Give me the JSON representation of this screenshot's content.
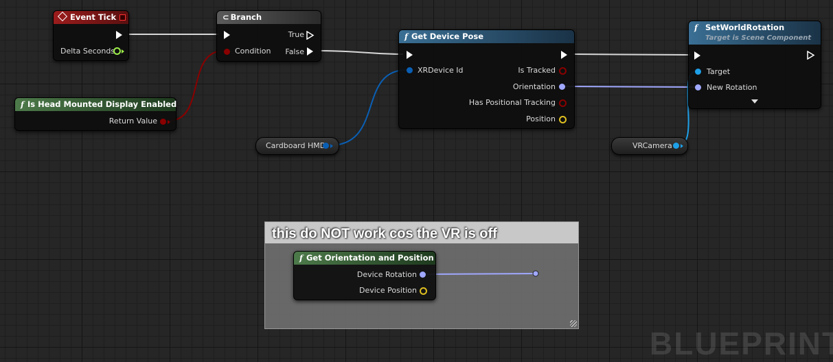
{
  "nodes": {
    "event_tick": {
      "title": "Event Tick",
      "delta_seconds": "Delta Seconds"
    },
    "branch": {
      "title": "Branch",
      "condition": "Condition",
      "true_label": "True",
      "false_label": "False"
    },
    "is_hmd_enabled": {
      "title": "Is Head Mounted Display Enabled",
      "return_value": "Return Value"
    },
    "get_device_pose": {
      "title": "Get Device Pose",
      "xr_device_id": "XRDevice Id",
      "is_tracked": "Is Tracked",
      "orientation": "Orientation",
      "has_positional_tracking": "Has Positional Tracking",
      "position": "Position"
    },
    "set_world_rotation": {
      "title": "SetWorldRotation",
      "subtitle": "Target is Scene Component",
      "target": "Target",
      "new_rotation": "New Rotation"
    },
    "cardboard_hmd": {
      "label": "Cardboard HMD"
    },
    "vr_camera": {
      "label": "VRCamera"
    },
    "get_orientation_position": {
      "title": "Get Orientation and Position",
      "device_rotation": "Device Rotation",
      "device_position": "Device Position"
    }
  },
  "comment": {
    "title": "this do NOT work cos the VR is off"
  },
  "watermark": "BLUEPRINT",
  "colors": {
    "event_header": "#8a1c1c",
    "function_header_blue": "#2e5a78",
    "function_header_green": "#3b6b3a",
    "branch_header": "#4a4a4a",
    "bool_pin": "#8a0000",
    "struct_pin": "#0a5fb4",
    "rotator_pin": "#a0a8ff",
    "vector_pin": "#e0c020",
    "float_pin": "#9ef04a",
    "object_pin": "#1ea0e8"
  }
}
